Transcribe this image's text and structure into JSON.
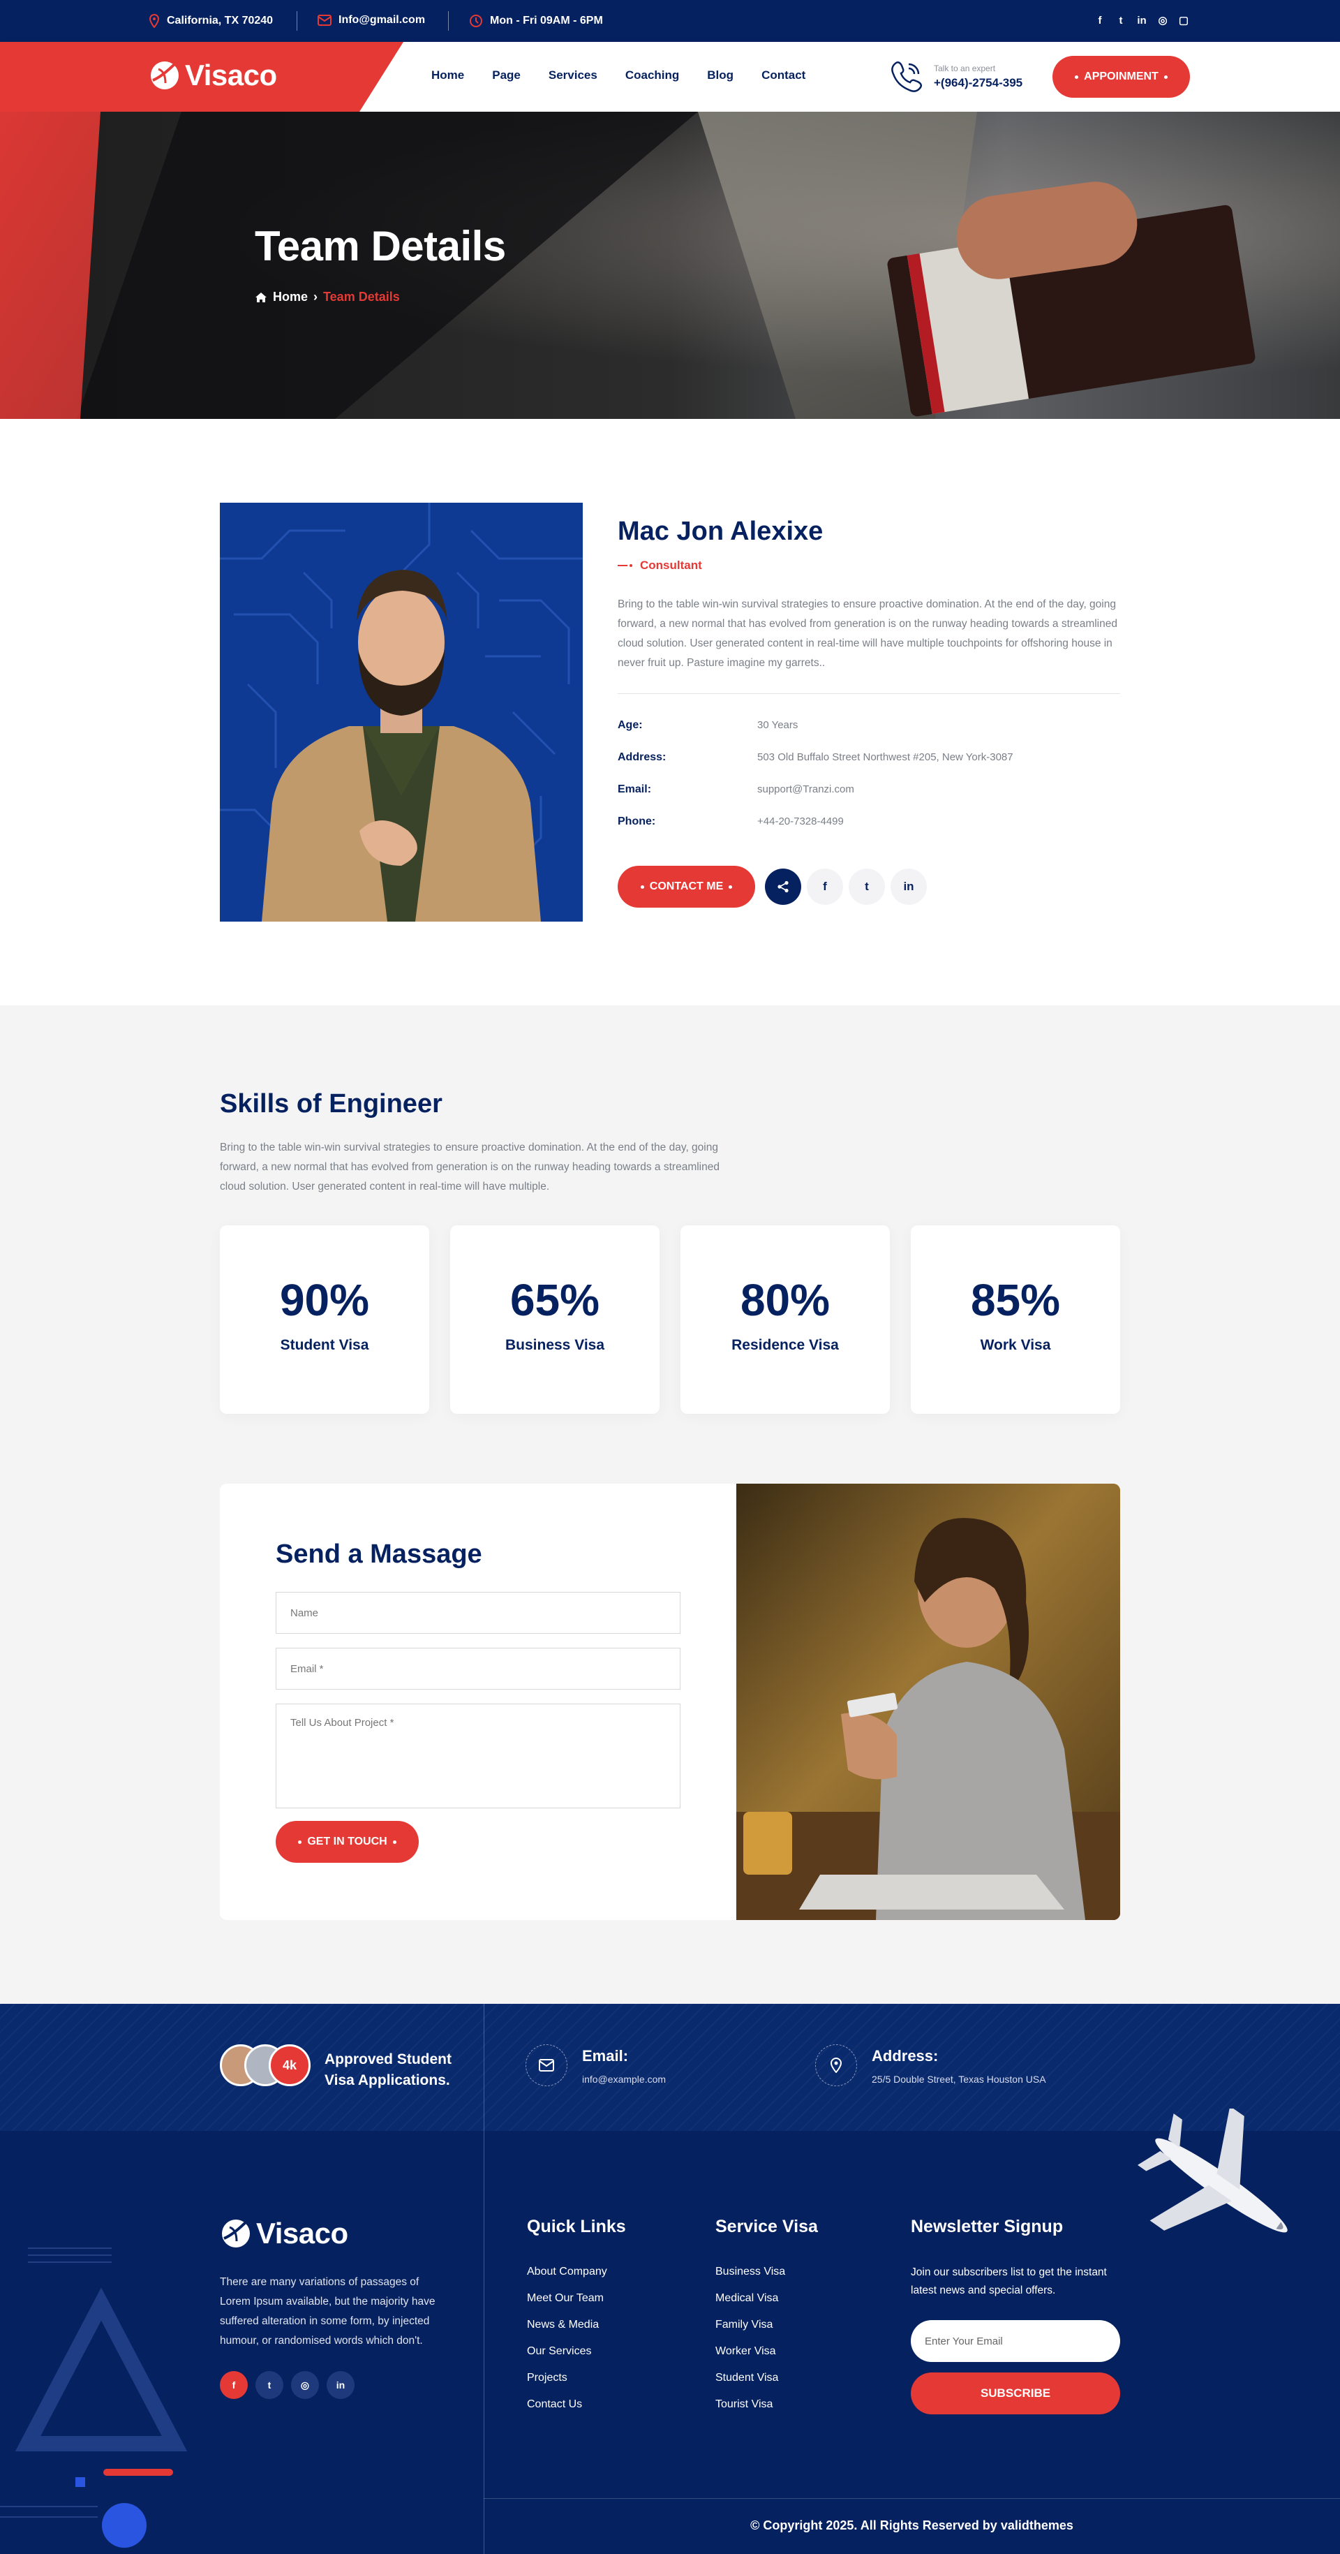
{
  "topbar": {
    "location": "California, TX 70240",
    "email": "Info@gmail.com",
    "hours": "Mon - Fri  09AM - 6PM",
    "social": [
      "facebook-icon",
      "twitter-icon",
      "linkedin-icon",
      "whatsapp-icon",
      "instagram-icon"
    ]
  },
  "header": {
    "logo_text": "Visaco",
    "nav": [
      "Home",
      "Page",
      "Services",
      "Coaching",
      "Blog",
      "Contact"
    ],
    "call_label": "Talk to an expert",
    "call_number": "+(964)-2754-395",
    "cta": "APPOINMENT"
  },
  "hero": {
    "title": "Team Details",
    "breadcrumb_home": "Home",
    "breadcrumb_current": "Team Details"
  },
  "member": {
    "name": "Mac Jon Alexixe",
    "role": "Consultant",
    "bio": "Bring to the table win-win survival strategies to ensure proactive domination. At the end of the day, going forward, a new normal that has evolved from generation is on the runway heading towards a streamlined cloud solution. User generated content in real-time will have multiple touchpoints for offshoring house in never fruit up. Pasture imagine my garrets..",
    "info": [
      {
        "label": "Age:",
        "value": "30 Years"
      },
      {
        "label": "Address:",
        "value": "503 Old Buffalo Street Northwest #205, New York-3087"
      },
      {
        "label": "Email:",
        "value": "support@Tranzi.com"
      },
      {
        "label": "Phone:",
        "value": "+44-20-7328-4499"
      }
    ],
    "contact_button": "CONTACT ME"
  },
  "skills": {
    "title": "Skills of Engineer",
    "description": "Bring to the table win-win survival strategies to ensure proactive domination. At the end of the day, going forward, a new normal that has evolved from generation is on the runway heading towards a streamlined cloud solution. User generated content in real-time will have multiple.",
    "items": [
      {
        "percent": "90%",
        "label": "Student Visa"
      },
      {
        "percent": "65%",
        "label": "Business Visa"
      },
      {
        "percent": "80%",
        "label": "Residence Visa"
      },
      {
        "percent": "85%",
        "label": "Work Visa"
      }
    ]
  },
  "contact_form": {
    "title": "Send a Massage",
    "name_placeholder": "Name",
    "email_placeholder": "Email *",
    "message_placeholder": "Tell Us About Project *",
    "submit": "GET IN TOUCH"
  },
  "footer": {
    "badge_count": "4k",
    "approved_text": "Approved Student Visa Applications.",
    "email_label": "Email:",
    "email_value": "info@example.com",
    "address_label": "Address:",
    "address_value": "25/5 Double Street, Texas Houston USA",
    "logo_text": "Visaco",
    "about": "There are many variations of passages of Lorem Ipsum available, but the majority have suffered alteration in some form, by injected humour, or randomised words which don't.",
    "quick_links_title": "Quick Links",
    "quick_links": [
      "About Company",
      "Meet Our Team",
      "News & Media",
      "Our Services",
      "Projects",
      "Contact Us"
    ],
    "service_title": "Service Visa",
    "service_links": [
      "Business Visa",
      "Medical Visa",
      "Family Visa",
      "Worker Visa",
      "Student Visa",
      "Tourist Visa"
    ],
    "newsletter_title": "Newsletter Signup",
    "newsletter_text": "Join our subscribers list to get the instant latest news and special offers.",
    "newsletter_placeholder": "Enter Your Email",
    "subscribe": "SUBSCRIBE",
    "copyright": "© Copyright 2025. All Rights Reserved by validthemes"
  },
  "colors": {
    "navy": "#06215f",
    "red": "#e53935",
    "light_bg": "#f4f4f4"
  }
}
